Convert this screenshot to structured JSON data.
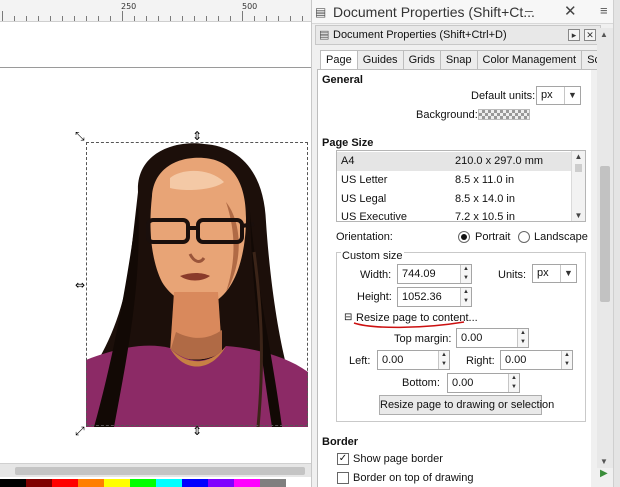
{
  "ruler": {
    "labels": [
      "250",
      "500"
    ]
  },
  "colors": {
    "accent_underline": "#cc1111",
    "palette": [
      "#000000",
      "#7f0000",
      "#ff0000",
      "#ff7f00",
      "#ffff00",
      "#00ff00",
      "#00ffff",
      "#0000ff",
      "#7f00ff",
      "#ff00ff",
      "#7f7f7f",
      "#ffffff"
    ]
  },
  "dock": {
    "title": "Document Properties (Shift+Ct...",
    "title_icon": "document-properties-icon",
    "minimize_glyph": "–",
    "close_glyph": "✕",
    "side_glyph": "≡"
  },
  "panel": {
    "title": "Document Properties (Shift+Ctrl+D)",
    "pin_glyph": "▸",
    "close_glyph": "✕"
  },
  "tabs": [
    {
      "label": "Page",
      "active": true
    },
    {
      "label": "Guides",
      "active": false
    },
    {
      "label": "Grids",
      "active": false
    },
    {
      "label": "Snap",
      "active": false
    },
    {
      "label": "Color Management",
      "active": false
    },
    {
      "label": "Scripting",
      "active": false
    }
  ],
  "general": {
    "heading": "General",
    "default_units_label": "Default units:",
    "default_units_value": "px",
    "background_label": "Background:"
  },
  "page_size": {
    "heading": "Page Size",
    "rows": [
      {
        "name": "A4",
        "dims": "210.0 x 297.0 mm",
        "selected": true
      },
      {
        "name": "US Letter",
        "dims": "8.5 x 11.0 in",
        "selected": false
      },
      {
        "name": "US Legal",
        "dims": "8.5 x 14.0 in",
        "selected": false
      },
      {
        "name": "US Executive",
        "dims": "7.2 x 10.5 in",
        "selected": false
      }
    ]
  },
  "orientation": {
    "label": "Orientation:",
    "portrait": "Portrait",
    "landscape": "Landscape",
    "selected": "portrait"
  },
  "custom_size": {
    "legend": "Custom size",
    "width_label": "Width:",
    "width_value": "744.09",
    "height_label": "Height:",
    "height_value": "1052.36",
    "units_label": "Units:",
    "units_value": "px"
  },
  "resize": {
    "expander_glyph": "⊟",
    "label": "Resize page to content...",
    "top_margin_label": "Top margin:",
    "top_margin_value": "0.00",
    "left_label": "Left:",
    "left_value": "0.00",
    "right_label": "Right:",
    "right_value": "0.00",
    "bottom_label": "Bottom:",
    "bottom_value": "0.00",
    "button_label": "Resize page to drawing or selection"
  },
  "border": {
    "heading": "Border",
    "show_border_label": "Show page border",
    "show_border_checked": true,
    "on_top_label": "Border on top of drawing",
    "on_top_checked": false
  }
}
